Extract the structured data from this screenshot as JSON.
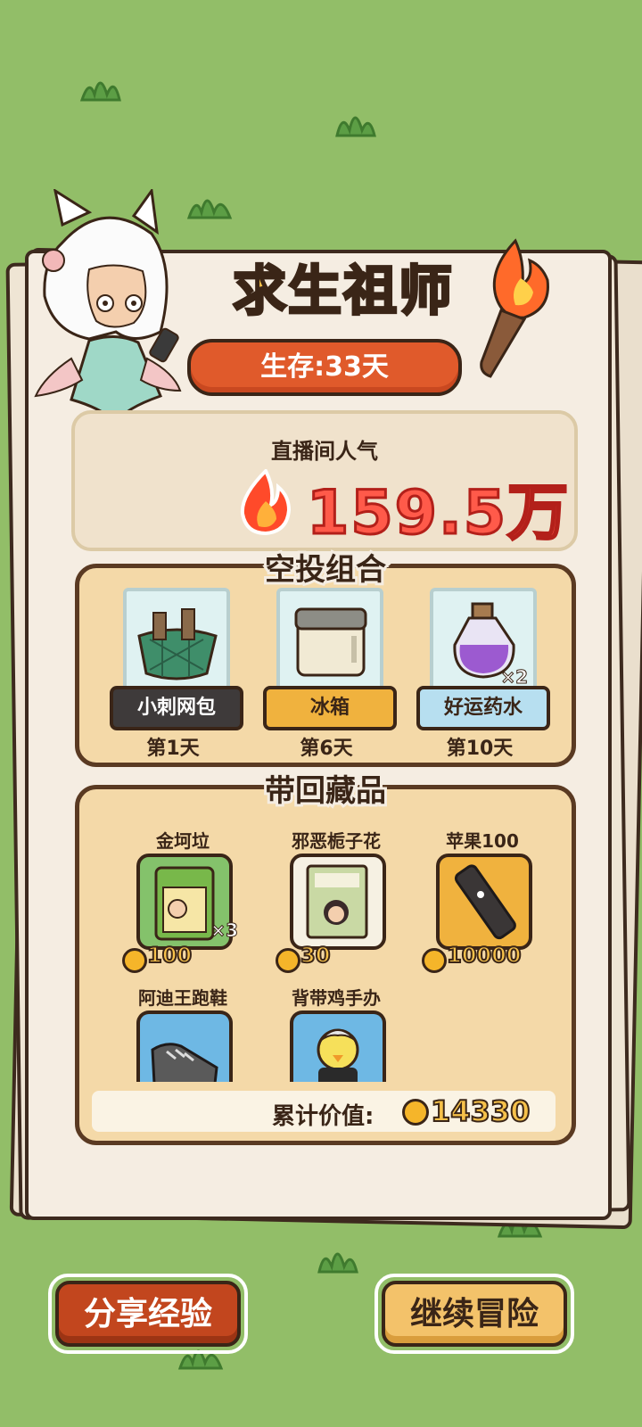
{
  "header": {
    "title": "求生祖师",
    "survival": "生存:33天"
  },
  "popularity": {
    "label": "直播间人气",
    "value": "159.5万"
  },
  "airdrop": {
    "title": "空投组合",
    "items": [
      {
        "name": "小刺网包",
        "day": "第1天",
        "qty": ""
      },
      {
        "name": "冰箱",
        "day": "第6天",
        "qty": ""
      },
      {
        "name": "好运药水",
        "day": "第10天",
        "qty": "×2"
      }
    ]
  },
  "collectibles": {
    "title": "带回藏品",
    "items": [
      {
        "name": "金坷垃",
        "price": "100",
        "qty": "×3"
      },
      {
        "name": "邪恶栀子花",
        "price": "30",
        "qty": ""
      },
      {
        "name": "苹果100",
        "price": "10000",
        "qty": ""
      },
      {
        "name": "阿迪王跑鞋",
        "price": "",
        "qty": ""
      },
      {
        "name": "背带鸡手办",
        "price": "",
        "qty": ""
      }
    ],
    "total_label": "累计价值:",
    "total_value": "14330"
  },
  "buttons": {
    "share": "分享经验",
    "continue": "继续冒险"
  },
  "colors": {
    "background": "#92be68",
    "accent_red": "#e05a2b",
    "gold": "#f6c14a"
  }
}
